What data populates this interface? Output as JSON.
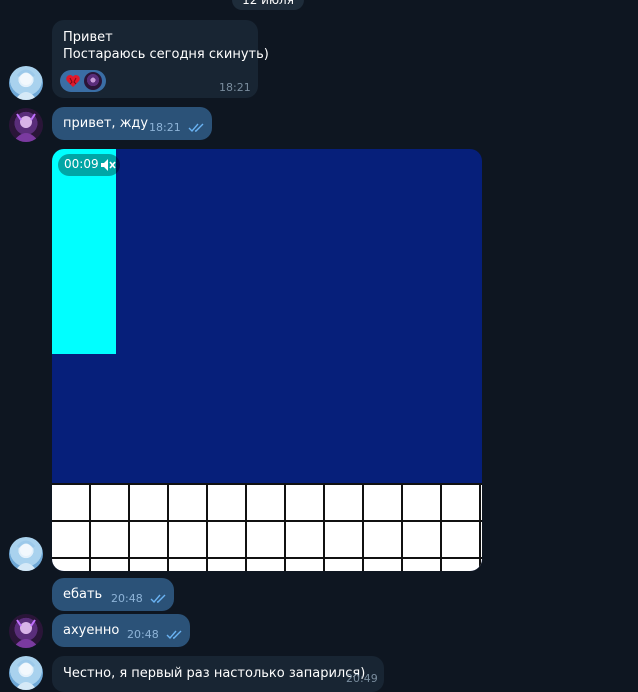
{
  "date_header": "12 июля",
  "messages": [
    {
      "text_line1": "Привет",
      "text_line2": "Постараюсь сегодня скинуть)",
      "time": "18:21",
      "reactions": [
        "heart-emoji",
        "avatar-reaction"
      ]
    },
    {
      "text": "привет, жду",
      "time": "18:21",
      "read": true
    },
    {
      "video_duration": "00:09",
      "muted": true
    },
    {
      "text": "ебать",
      "time": "20:48",
      "read": true
    },
    {
      "text": "ахуенно",
      "time": "20:48",
      "read": true
    },
    {
      "text": "Честно, я первый раз настолько запарился)",
      "time": "20:49"
    }
  ],
  "colors": {
    "background": "#0e1621",
    "incoming_bubble": "#182533",
    "outgoing_bubble": "#2b5278",
    "read_ticks": "#6ab3f3"
  }
}
